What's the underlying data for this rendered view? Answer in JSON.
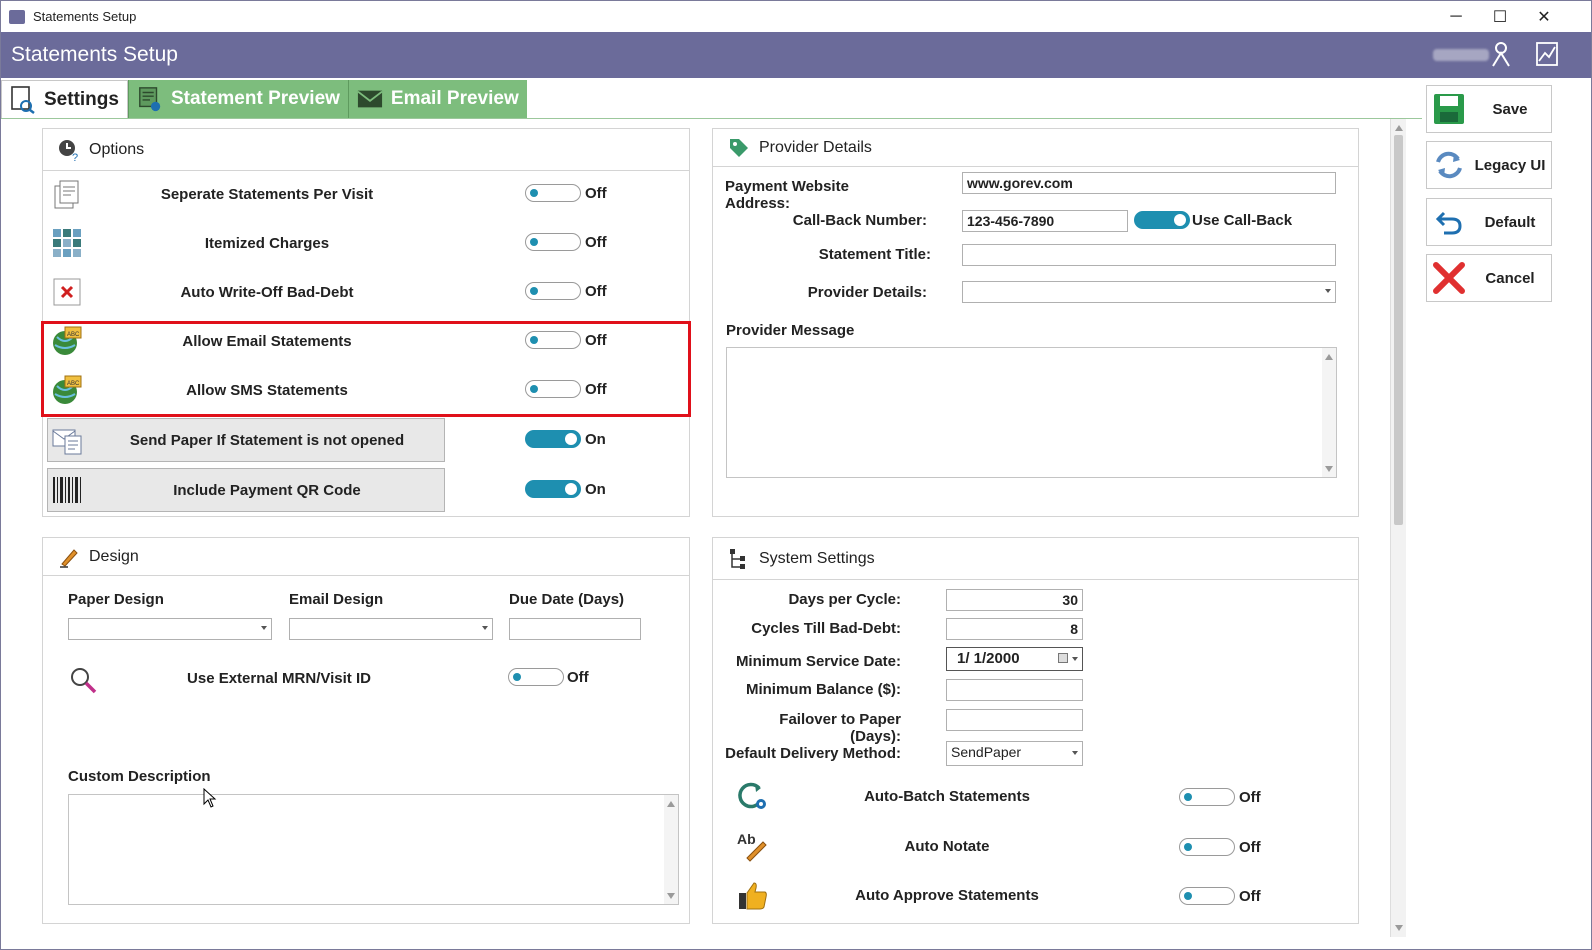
{
  "window": {
    "title": "Statements Setup",
    "minimize": "─",
    "maximize": "☐",
    "close": "✕"
  },
  "header": {
    "title": "Statements Setup"
  },
  "tabs": [
    {
      "label": "Settings"
    },
    {
      "label": "Statement Preview"
    },
    {
      "label": "Email Preview"
    }
  ],
  "options": {
    "title": "Options",
    "rows": [
      {
        "label": "Seperate Statements Per Visit",
        "state": "Off"
      },
      {
        "label": "Itemized Charges",
        "state": "Off"
      },
      {
        "label": "Auto Write-Off Bad-Debt",
        "state": "Off"
      },
      {
        "label": "Allow Email Statements",
        "state": "Off"
      },
      {
        "label": "Allow SMS Statements",
        "state": "Off"
      },
      {
        "label": "Send Paper If Statement is not opened",
        "state": "On"
      },
      {
        "label": "Include Payment QR Code",
        "state": "On"
      }
    ]
  },
  "provider": {
    "title": "Provider Details",
    "payment_website_label": "Payment Website Address:",
    "payment_website_value": "www.gorev.com",
    "callback_label": "Call-Back Number:",
    "callback_value": "123-456-7890",
    "use_callback_label": "Use Call-Back",
    "statement_title_label": "Statement Title:",
    "statement_title_value": "",
    "provider_details_label": "Provider Details:",
    "provider_details_value": "",
    "provider_message_label": "Provider Message"
  },
  "design": {
    "title": "Design",
    "paper_design_label": "Paper Design",
    "email_design_label": "Email Design",
    "due_date_label": "Due Date (Days)",
    "external_mrn_label": "Use External MRN/Visit ID",
    "external_mrn_state": "Off",
    "custom_description_label": "Custom Description"
  },
  "system": {
    "title": "System Settings",
    "days_per_cycle_label": "Days per Cycle:",
    "days_per_cycle_value": "30",
    "cycles_bad_debt_label": "Cycles Till Bad-Debt:",
    "cycles_bad_debt_value": "8",
    "min_service_date_label": "Minimum Service Date:",
    "min_service_date_value": "1/  1/2000",
    "min_balance_label": "Minimum Balance ($):",
    "min_balance_value": "",
    "failover_label": "Failover to Paper (Days):",
    "failover_value": "",
    "delivery_label": "Default Delivery Method:",
    "delivery_value": "SendPaper",
    "rows": [
      {
        "label": "Auto-Batch Statements",
        "state": "Off"
      },
      {
        "label": "Auto Notate",
        "state": "Off"
      },
      {
        "label": "Auto Approve Statements",
        "state": "Off"
      }
    ]
  },
  "side_buttons": {
    "save": "Save",
    "legacy": "Legacy UI",
    "default": "Default",
    "cancel": "Cancel"
  },
  "colors": {
    "header": "#6b6b9a",
    "tab_inactive": "#7dbd7d",
    "toggle_accent": "#1e8fb0",
    "highlight": "#e0101a"
  }
}
